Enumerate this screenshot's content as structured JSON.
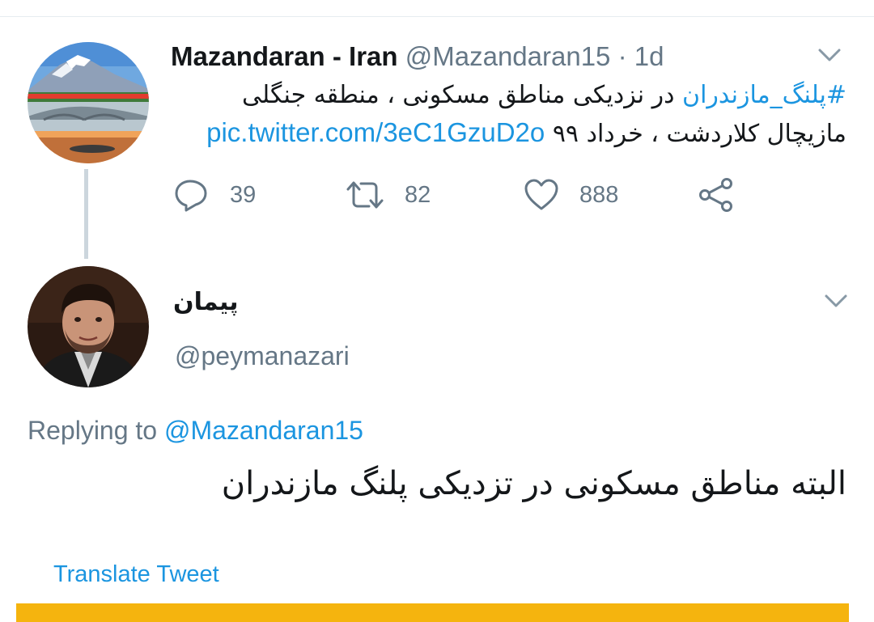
{
  "colors": {
    "link": "#1b95e0",
    "muted": "#657786",
    "text": "#14171a",
    "thread_line": "#ccd6dd",
    "banner": "#f5b40e"
  },
  "tweet1": {
    "author_name": "Mazandaran - Iran",
    "handle": "@Mazandaran15",
    "separator": "·",
    "time": "1d",
    "hashtag": "#پلنگ_مازندران",
    "line1_rest": " در نزدیکی مناطق مسکونی ، منطقه جنگلی",
    "line2_text": "مازیچال کلاردشت ، خرداد ۹۹ ",
    "pic_link": "pic.twitter.com/3eC1GzuD2o",
    "avatar_icon": "mountain-landscape-avatar",
    "menu_icon": "chevron-down-icon",
    "actions": {
      "reply": {
        "icon": "reply-icon",
        "count": "39"
      },
      "retweet": {
        "icon": "retweet-icon",
        "count": "82"
      },
      "like": {
        "icon": "heart-icon",
        "count": "888"
      },
      "share": {
        "icon": "share-icon"
      }
    }
  },
  "tweet2": {
    "author_name": "پیمان",
    "handle": "@peymanazari",
    "avatar_icon": "person-avatar",
    "menu_icon": "chevron-down-icon",
    "replying_label": "Replying to ",
    "replying_to": "@Mazandaran15",
    "body": "البته مناطق مسکونی در تزدیکی پلنگ مازندران",
    "translate_label": "Translate Tweet"
  }
}
